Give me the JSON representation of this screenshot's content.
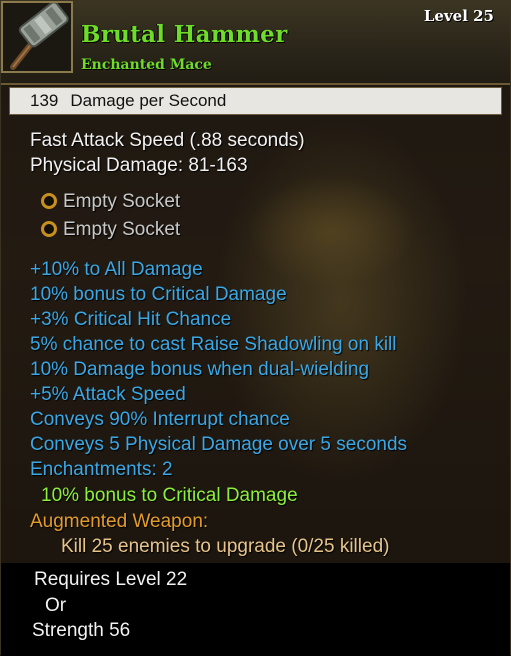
{
  "item": {
    "name": "Brutal Hammer",
    "type": "Enchanted Mace",
    "level_label": "Level 25",
    "icon": "hammer-icon"
  },
  "stats": {
    "dps_value": "139",
    "dps_label": "Damage per Second",
    "attack_speed": "Fast Attack Speed (.88 seconds)",
    "physical_damage": "Physical Damage: 81-163"
  },
  "sockets": [
    {
      "label": "Empty Socket",
      "icon": "socket-ring-icon"
    },
    {
      "label": "Empty Socket",
      "icon": "socket-ring-icon"
    }
  ],
  "affixes": [
    "+10% to All Damage",
    "10% bonus to Critical Damage",
    "+3% Critical Hit Chance",
    "5% chance to cast Raise Shadowling on kill",
    "10% Damage bonus when dual-wielding",
    "+5% Attack Speed",
    "Conveys 90% Interrupt chance",
    "Conveys 5 Physical Damage over 5 seconds",
    "Enchantments: 2"
  ],
  "enchantment": "10% bonus to Critical Damage",
  "augmented": {
    "label": "Augmented Weapon:",
    "progress_text": "Kill 25 enemies to upgrade (0/25 killed)"
  },
  "requirements": {
    "level": "Requires Level 22",
    "or": "Or",
    "strength": "Strength 56"
  },
  "colors": {
    "title_green": "#6fdc2a",
    "affix_blue": "#3aa8e6",
    "enchant_green": "#8cf03a",
    "augment_orange": "#e39c2a",
    "socket_ring": "#c8901e"
  }
}
